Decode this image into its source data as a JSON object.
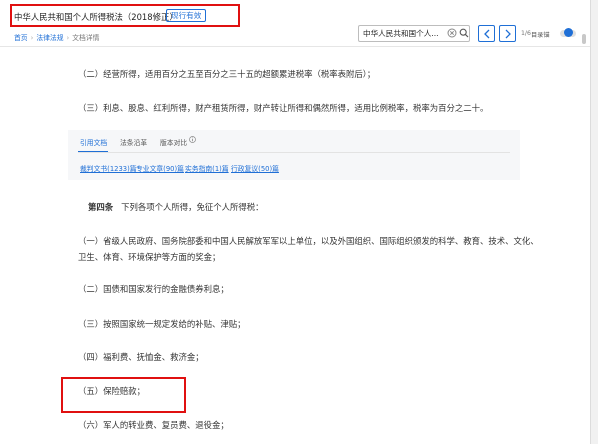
{
  "header": {
    "title": "中华人民共和国个人所得税法（2018修正）",
    "status_badge": "现行有效"
  },
  "breadcrumb": [
    "首页",
    "法律法规",
    "文档详情"
  ],
  "search": {
    "value": "中华人民共和国个人...",
    "placeholder": ""
  },
  "toolbar": {
    "match_count": "1/6",
    "toggle_label": "目录锚"
  },
  "content": {
    "para_business": "（二）经营所得，适用百分之五至百分之三十五的超额累进税率（税率表附后）；",
    "para_interest": "（三）利息、股息、红利所得，财产租赁所得，财产转让所得和偶然所得，适用比例税率，税率为百分之二十。",
    "tabs": [
      "引用文档",
      "法条沿革",
      "版本对比"
    ],
    "related_links": [
      "裁判文书(1233)篇",
      "专业文章(90)篇",
      "实务指南(1)篇",
      "行政复议(50)篇"
    ],
    "article_label": "第四条",
    "article_text": "下列各项个人所得，免征个人所得税：",
    "items": [
      "（一）省级人民政府、国务院部委和中国人民解放军军以上单位，以及外国组织、国际组织颁发的科学、教育、技术、文化、",
      "卫生、体育、环境保护等方面的奖金；",
      "（二）国债和国家发行的金融债券利息；",
      "（三）按照国家统一规定发给的补贴、津贴；",
      "（四）福利费、抚恤金、救济金；",
      "（五）保险赔款；",
      "（六）军人的转业费、复员费、退役金；"
    ]
  },
  "colors": {
    "accent": "#1f6fd6",
    "highlight_box": "#e01010",
    "body_text": "#333333"
  }
}
